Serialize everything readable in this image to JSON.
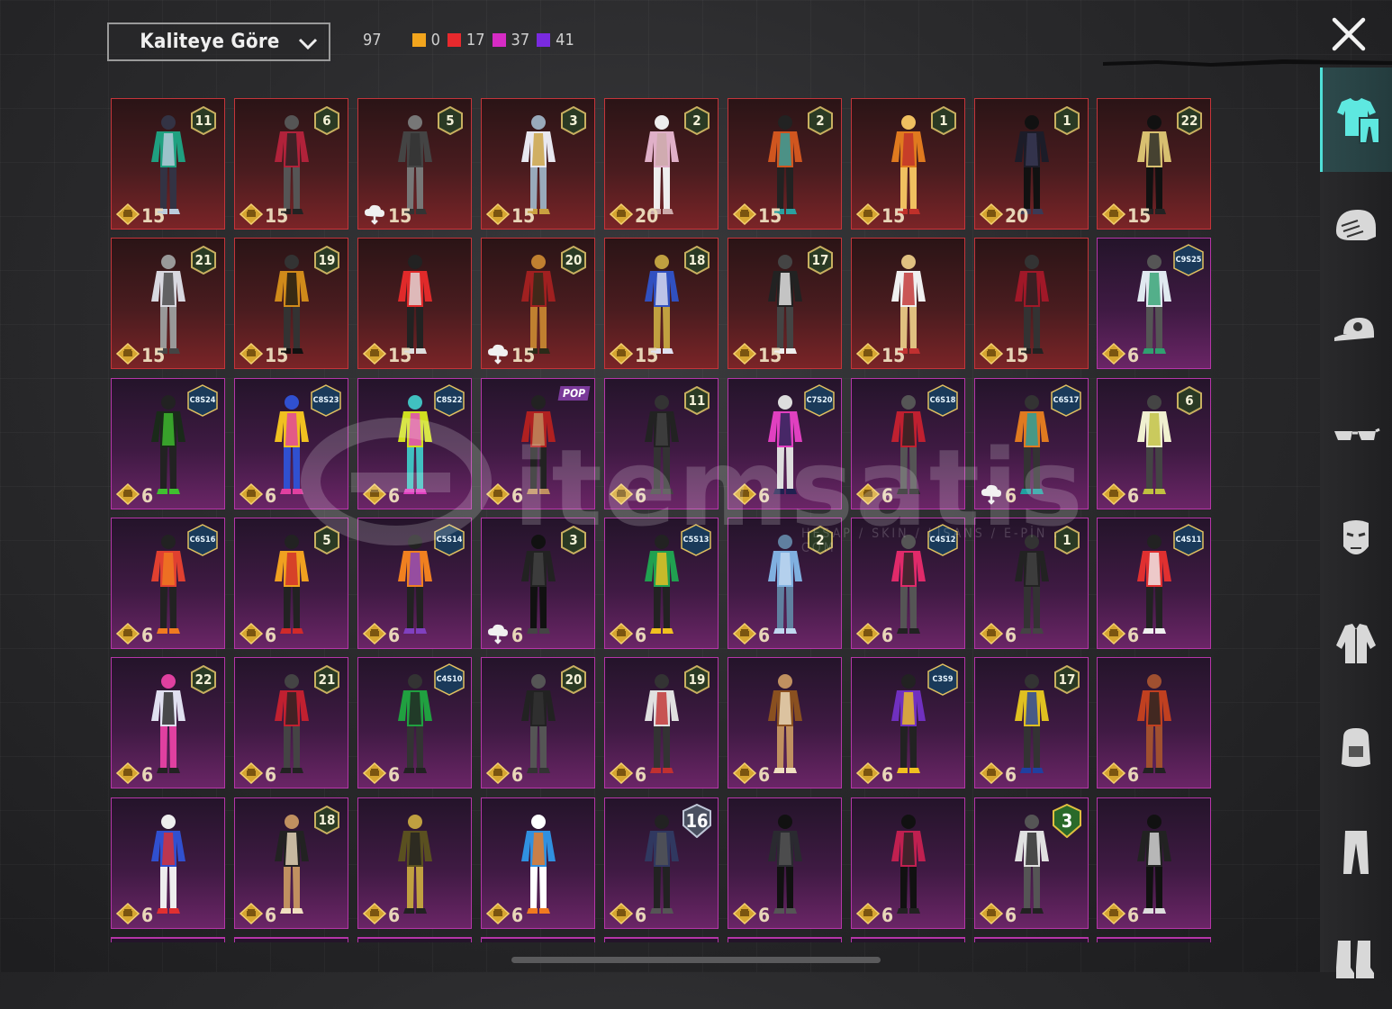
{
  "sort": {
    "label": "Kaliteye Göre"
  },
  "counts": {
    "total": "97",
    "legend": [
      {
        "color": "#f2a51d",
        "value": "0"
      },
      {
        "color": "#e8292d",
        "value": "17"
      },
      {
        "color": "#d62bc4",
        "value": "37"
      },
      {
        "color": "#7a2ae0",
        "value": "41"
      }
    ]
  },
  "watermark": {
    "text": "itemsatis",
    "sub": "HESAP / SKIN / LİSANS / E-PİN . COM"
  },
  "sidebar": {
    "items": [
      {
        "name": "outfit-icon",
        "active": true
      },
      {
        "name": "helmet-icon",
        "active": false
      },
      {
        "name": "cap-icon",
        "active": false
      },
      {
        "name": "glasses-icon",
        "active": false
      },
      {
        "name": "mask-icon",
        "active": false
      },
      {
        "name": "jacket-icon",
        "active": false
      },
      {
        "name": "backpack-icon",
        "active": false
      },
      {
        "name": "pants-icon",
        "active": false
      },
      {
        "name": "boots-icon",
        "active": false
      }
    ]
  },
  "items": [
    {
      "tier": "red",
      "badge_type": "level",
      "badge": "11",
      "price": "15",
      "coin": "gold",
      "palette": [
        "#1fa080",
        "#bcd",
        "#334"
      ]
    },
    {
      "tier": "red",
      "badge_type": "level",
      "badge": "6",
      "price": "15",
      "coin": "gold",
      "palette": [
        "#b0223a",
        "#222",
        "#555"
      ]
    },
    {
      "tier": "red",
      "badge_type": "level",
      "badge": "5",
      "price": "15",
      "coin": "cloud",
      "palette": [
        "#444",
        "#333",
        "#777"
      ]
    },
    {
      "tier": "red",
      "badge_type": "level",
      "badge": "3",
      "price": "15",
      "coin": "gold",
      "palette": [
        "#e8e8f0",
        "#c9a040",
        "#9ab"
      ]
    },
    {
      "tier": "red",
      "badge_type": "level",
      "badge": "2",
      "price": "20",
      "coin": "gold",
      "palette": [
        "#e0b0c8",
        "#caa",
        "#eee"
      ]
    },
    {
      "tier": "red",
      "badge_type": "level",
      "badge": "2",
      "price": "15",
      "coin": "gold",
      "palette": [
        "#d0561f",
        "#2aa0a0",
        "#222"
      ]
    },
    {
      "tier": "red",
      "badge_type": "level",
      "badge": "1",
      "price": "15",
      "coin": "gold",
      "palette": [
        "#e07a1f",
        "#c0302a",
        "#f0c060"
      ]
    },
    {
      "tier": "red",
      "badge_type": "level",
      "badge": "1",
      "price": "20",
      "coin": "gold",
      "palette": [
        "#1c1c28",
        "#3a3a55",
        "#111"
      ]
    },
    {
      "tier": "red",
      "badge_type": "level",
      "badge": "22",
      "price": "15",
      "coin": "gold",
      "palette": [
        "#d8c070",
        "#222",
        "#111"
      ]
    },
    {
      "tier": "red",
      "badge_type": "level",
      "badge": "21",
      "price": "15",
      "coin": "gold",
      "palette": [
        "#d8d8e0",
        "#444",
        "#999"
      ]
    },
    {
      "tier": "red",
      "badge_type": "level",
      "badge": "19",
      "price": "15",
      "coin": "gold",
      "palette": [
        "#d08a1a",
        "#111",
        "#333"
      ]
    },
    {
      "tier": "red",
      "badge_type": "level",
      "badge": "",
      "price": "15",
      "coin": "gold",
      "palette": [
        "#e02a2a",
        "#ddd",
        "#222"
      ]
    },
    {
      "tier": "red",
      "badge_type": "level",
      "badge": "20",
      "price": "15",
      "coin": "cloud",
      "palette": [
        "#a02020",
        "#2a2a18",
        "#c08030"
      ]
    },
    {
      "tier": "red",
      "badge_type": "level",
      "badge": "18",
      "price": "15",
      "coin": "gold",
      "palette": [
        "#3050c0",
        "#e0e0f0",
        "#c0a040"
      ]
    },
    {
      "tier": "red",
      "badge_type": "level",
      "badge": "17",
      "price": "15",
      "coin": "gold",
      "palette": [
        "#222",
        "#eee",
        "#444"
      ]
    },
    {
      "tier": "red",
      "badge_type": "level",
      "badge": "",
      "price": "15",
      "coin": "gold",
      "palette": [
        "#f0f0f0",
        "#c03030",
        "#e0c080"
      ]
    },
    {
      "tier": "red",
      "badge_type": "level",
      "badge": "",
      "price": "15",
      "coin": "gold",
      "palette": [
        "#a01828",
        "#222",
        "#333"
      ]
    },
    {
      "tier": "purple",
      "badge_type": "season",
      "badge": "C9S25",
      "price": "6",
      "coin": "gold",
      "palette": [
        "#e0e8f0",
        "#30a070",
        "#555"
      ]
    },
    {
      "tier": "purple",
      "badge_type": "season",
      "badge": "C8S24",
      "price": "6",
      "coin": "gold",
      "palette": [
        "#1a2a1a",
        "#40c030",
        "#222"
      ]
    },
    {
      "tier": "purple",
      "badge_type": "season",
      "badge": "C8S23",
      "price": "6",
      "coin": "gold",
      "palette": [
        "#f0c020",
        "#e040a0",
        "#3050d0"
      ]
    },
    {
      "tier": "purple",
      "badge_type": "season",
      "badge": "C8S22",
      "price": "6",
      "coin": "gold",
      "palette": [
        "#d0e020",
        "#e040c0",
        "#40c0c0"
      ]
    },
    {
      "tier": "purple",
      "badge_type": "pop",
      "badge": "POP",
      "price": "6",
      "coin": "gold",
      "palette": [
        "#b02020",
        "#c09060",
        "#222"
      ]
    },
    {
      "tier": "purple",
      "badge_type": "level",
      "badge": "11",
      "price": "6",
      "coin": "gold",
      "palette": [
        "#222",
        "#444",
        "#333"
      ]
    },
    {
      "tier": "purple",
      "badge_type": "season",
      "badge": "C7S20",
      "price": "6",
      "coin": "gold",
      "palette": [
        "#e040c0",
        "#202050",
        "#ddd"
      ]
    },
    {
      "tier": "purple",
      "badge_type": "season",
      "badge": "C6S18",
      "price": "6",
      "coin": "gold",
      "palette": [
        "#c02030",
        "#222",
        "#555"
      ]
    },
    {
      "tier": "purple",
      "badge_type": "season",
      "badge": "C6S17",
      "price": "6",
      "coin": "cloud",
      "palette": [
        "#e07a20",
        "#20a0a0",
        "#333"
      ]
    },
    {
      "tier": "purple",
      "badge_type": "level",
      "badge": "6",
      "price": "6",
      "coin": "gold",
      "palette": [
        "#f0f0d0",
        "#c0c040",
        "#444"
      ]
    },
    {
      "tier": "purple",
      "badge_type": "season",
      "badge": "C6S16",
      "price": "6",
      "coin": "gold",
      "palette": [
        "#e04030",
        "#f07a20",
        "#222"
      ]
    },
    {
      "tier": "purple",
      "badge_type": "level",
      "badge": "5",
      "price": "6",
      "coin": "gold",
      "palette": [
        "#f0a020",
        "#d02a2a",
        "#222"
      ]
    },
    {
      "tier": "purple",
      "badge_type": "season",
      "badge": "C5S14",
      "price": "6",
      "coin": "gold",
      "palette": [
        "#f08020",
        "#8040c0",
        "#222"
      ]
    },
    {
      "tier": "purple",
      "badge_type": "level",
      "badge": "3",
      "price": "6",
      "coin": "cloud",
      "palette": [
        "#222",
        "#444",
        "#111"
      ]
    },
    {
      "tier": "purple",
      "badge_type": "season",
      "badge": "C5S13",
      "price": "6",
      "coin": "gold",
      "palette": [
        "#20a050",
        "#f0c020",
        "#222"
      ]
    },
    {
      "tier": "purple",
      "badge_type": "level",
      "badge": "2",
      "price": "6",
      "coin": "gold",
      "palette": [
        "#80b0e0",
        "#c0d8f0",
        "#6080a0"
      ]
    },
    {
      "tier": "purple",
      "badge_type": "season",
      "badge": "C4S12",
      "price": "6",
      "coin": "gold",
      "palette": [
        "#e02a6a",
        "#222",
        "#555"
      ]
    },
    {
      "tier": "purple",
      "badge_type": "level",
      "badge": "1",
      "price": "6",
      "coin": "gold",
      "palette": [
        "#222",
        "#444",
        "#333"
      ]
    },
    {
      "tier": "purple",
      "badge_type": "season",
      "badge": "C4S11",
      "price": "6",
      "coin": "gold",
      "palette": [
        "#e03030",
        "#f0f0f0",
        "#222"
      ]
    },
    {
      "tier": "purple",
      "badge_type": "level",
      "badge": "22",
      "price": "6",
      "coin": "gold",
      "palette": [
        "#e0e0f0",
        "#222",
        "#e040a0"
      ]
    },
    {
      "tier": "purple",
      "badge_type": "level",
      "badge": "21",
      "price": "6",
      "coin": "gold",
      "palette": [
        "#c02030",
        "#222",
        "#444"
      ]
    },
    {
      "tier": "purple",
      "badge_type": "season",
      "badge": "C4S10",
      "price": "6",
      "coin": "gold",
      "palette": [
        "#20a040",
        "#222",
        "#333"
      ]
    },
    {
      "tier": "purple",
      "badge_type": "level",
      "badge": "20",
      "price": "6",
      "coin": "gold",
      "palette": [
        "#222",
        "#333",
        "#555"
      ]
    },
    {
      "tier": "purple",
      "badge_type": "level",
      "badge": "19",
      "price": "6",
      "coin": "gold",
      "palette": [
        "#e0e0e0",
        "#c03030",
        "#333"
      ]
    },
    {
      "tier": "purple",
      "badge_type": "none",
      "badge": "",
      "price": "6",
      "coin": "gold",
      "palette": [
        "#8a5020",
        "#f0e0c0",
        "#c09060"
      ]
    },
    {
      "tier": "purple",
      "badge_type": "season",
      "badge": "C3S9",
      "price": "6",
      "coin": "gold",
      "palette": [
        "#7030c0",
        "#f0c020",
        "#222"
      ]
    },
    {
      "tier": "purple",
      "badge_type": "level",
      "badge": "17",
      "price": "6",
      "coin": "gold",
      "palette": [
        "#e0c020",
        "#2040a0",
        "#333"
      ]
    },
    {
      "tier": "purple",
      "badge_type": "none",
      "badge": "",
      "price": "6",
      "coin": "gold",
      "palette": [
        "#c04020",
        "#222",
        "#a05030"
      ]
    },
    {
      "tier": "purple",
      "badge_type": "none",
      "badge": "",
      "price": "6",
      "coin": "gold",
      "palette": [
        "#3050d0",
        "#e03030",
        "#eee"
      ]
    },
    {
      "tier": "purple",
      "badge_type": "level",
      "badge": "18",
      "price": "6",
      "coin": "gold",
      "palette": [
        "#222",
        "#f0e0c0",
        "#c09060"
      ]
    },
    {
      "tier": "purple",
      "badge_type": "none",
      "badge": "",
      "price": "6",
      "coin": "gold",
      "palette": [
        "#5a5020",
        "#222",
        "#c0a040"
      ]
    },
    {
      "tier": "purple",
      "badge_type": "none",
      "badge": "",
      "price": "6",
      "coin": "gold",
      "palette": [
        "#3090e0",
        "#f07a20",
        "#fff"
      ]
    },
    {
      "tier": "purple",
      "badge_type": "big",
      "badge": "16",
      "price": "6",
      "coin": "gold",
      "palette": [
        "#303860",
        "#555",
        "#222"
      ]
    },
    {
      "tier": "purple",
      "badge_type": "none",
      "badge": "",
      "price": "6",
      "coin": "gold",
      "palette": [
        "#2a2a30",
        "#555",
        "#111"
      ]
    },
    {
      "tier": "purple",
      "badge_type": "none",
      "badge": "",
      "price": "6",
      "coin": "gold",
      "palette": [
        "#c02050",
        "#222",
        "#111"
      ]
    },
    {
      "tier": "purple",
      "badge_type": "bigshield",
      "badge": "3",
      "price": "6",
      "coin": "gold",
      "palette": [
        "#e0e0e0",
        "#222",
        "#555"
      ]
    },
    {
      "tier": "purple",
      "badge_type": "none",
      "badge": "",
      "price": "6",
      "coin": "gold",
      "palette": [
        "#222",
        "#ddd",
        "#111"
      ]
    }
  ]
}
